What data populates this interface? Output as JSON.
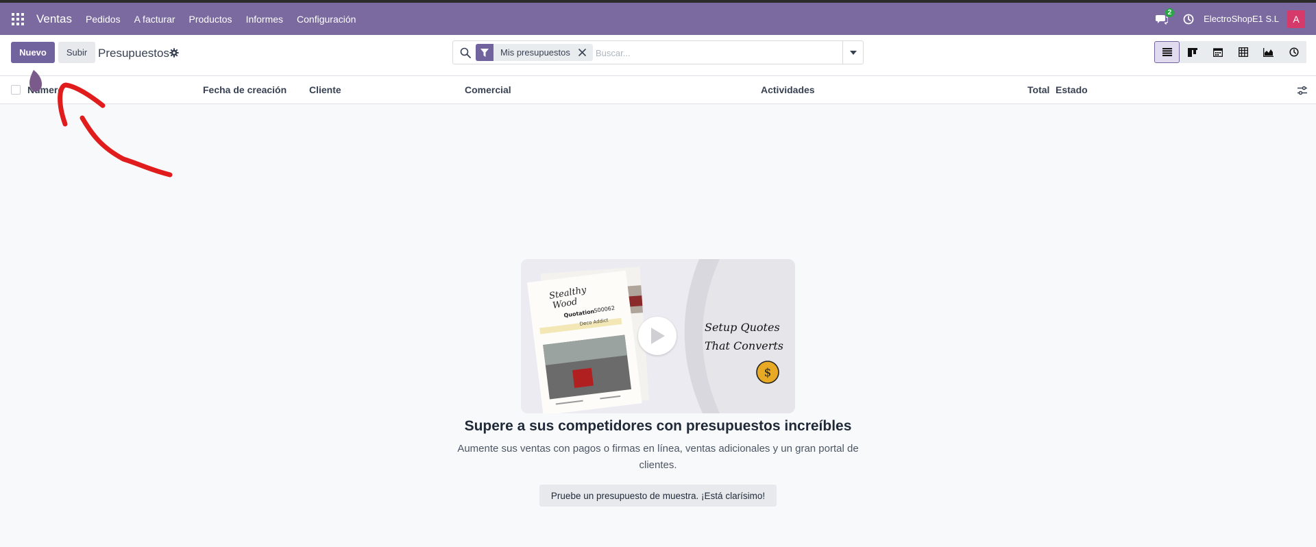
{
  "navbar": {
    "brand": "Ventas",
    "menu": [
      "Pedidos",
      "A facturar",
      "Productos",
      "Informes",
      "Configuración"
    ],
    "chat_count": "2",
    "company": "ElectroShopE1 S.L",
    "avatar_letter": "A"
  },
  "control": {
    "new_label": "Nuevo",
    "upload_label": "Subir",
    "title": "Presupuestos",
    "search": {
      "facet": "Mis presupuestos",
      "placeholder": "Buscar..."
    },
    "views": [
      "list-view-icon",
      "kanban-view-icon",
      "calendar-view-icon",
      "pivot-view-icon",
      "graph-view-icon",
      "activity-view-icon"
    ],
    "active_view": "list"
  },
  "table": {
    "columns": [
      "Número",
      "Fecha de creación",
      "Cliente",
      "Comercial",
      "Actividades",
      "Total",
      "Estado"
    ]
  },
  "empty_state": {
    "promo": {
      "logo_line1": "Stealthy",
      "logo_line2": "Wood",
      "quotation_label": "Quotation",
      "quotation_number": "S00062",
      "customer": "Deco Addict",
      "headline_1": "Setup Quotes",
      "headline_2": "That Converts"
    },
    "title": "Supere a sus competidores con presupuestos increíbles",
    "description": "Aumente sus ventas con pagos o firmas en línea, ventas adicionales y un gran portal de clientes.",
    "sample_button": "Pruebe un presupuesto de muestra. ¡Está clarísimo!"
  },
  "colors": {
    "navbar": "#7a6a9f",
    "primary": "#71639e",
    "annotation": "#e01c1c",
    "badge": "#28a745",
    "avatar": "#d63a6a"
  }
}
